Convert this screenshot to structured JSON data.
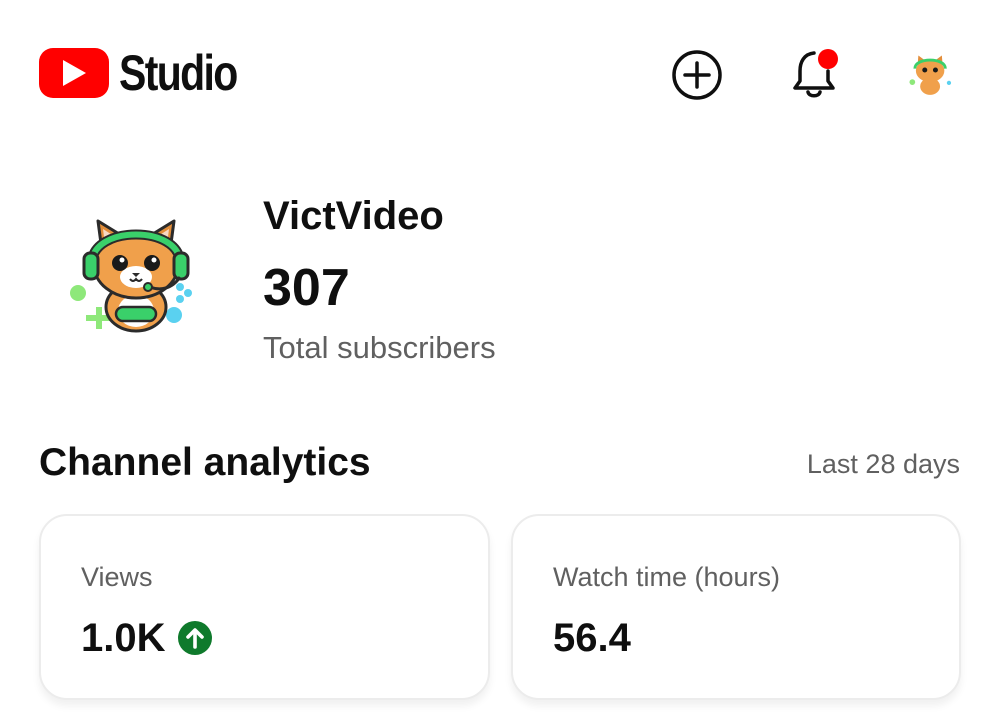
{
  "header": {
    "logo_text": "Studio",
    "icons": {
      "logo": "youtube-play-icon",
      "create": "plus-circle-icon",
      "notifications": "bell-icon",
      "account": "cat-avatar-icon"
    },
    "colors": {
      "brand_red": "#ff0000",
      "notification_dot": "#ff0000"
    }
  },
  "channel": {
    "name": "VictVideo",
    "subscriber_count": "307",
    "subscriber_label": "Total subscribers",
    "avatar_icon": "gamer-cat-avatar-icon"
  },
  "analytics": {
    "title": "Channel analytics",
    "range": "Last 28 days",
    "cards": [
      {
        "label": "Views",
        "value": "1.0K",
        "trend_icon": "arrow-up-circle-icon",
        "trend_color": "#0f7a2c"
      },
      {
        "label": "Watch time (hours)",
        "value": "56.4"
      }
    ]
  }
}
